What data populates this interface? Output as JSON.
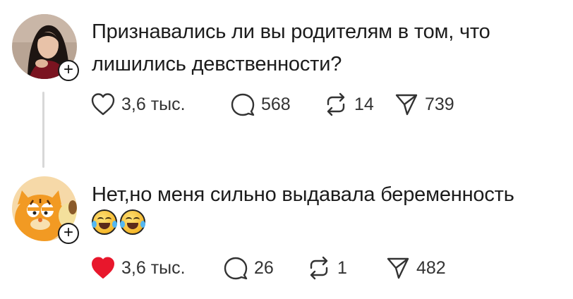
{
  "posts": [
    {
      "text_lines": [
        "Признавались ли вы родителям в том, что",
        "лишились девственности?"
      ],
      "likes": "3,6 тыс.",
      "comments": "568",
      "reposts": "14",
      "shares": "739",
      "liked": false,
      "avatar_icon": "avatar-woman-photo",
      "follow_symbol": "+"
    },
    {
      "text_lines": [
        "Нет,но меня сильно выдавала беременность"
      ],
      "emojis": [
        "laughing-tears-emoji",
        "laughing-tears-emoji"
      ],
      "likes": "3,6 тыс.",
      "comments": "26",
      "reposts": "1",
      "shares": "482",
      "liked": true,
      "avatar_icon": "avatar-garfield",
      "follow_symbol": "+"
    }
  ],
  "colors": {
    "text": "#1c1c1c",
    "icon": "#333333",
    "like_active": "#e8172c",
    "thread_line": "#d8d8d8"
  }
}
